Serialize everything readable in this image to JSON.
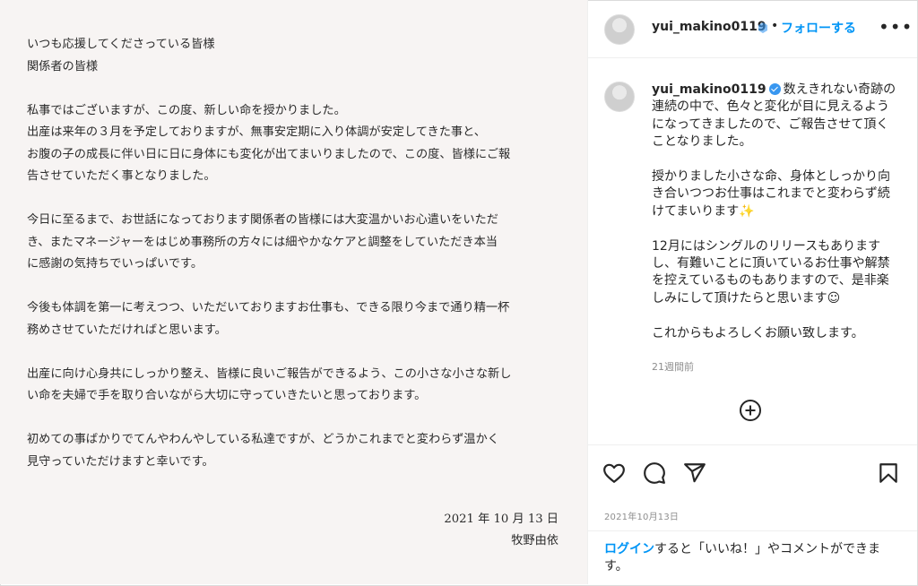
{
  "letter": {
    "paragraphs": [
      "いつも応援してくださっている皆様\n関係者の皆様",
      "私事ではございますが、この度、新しい命を授かりました。\n出産は来年の３月を予定しておりますが、無事安定期に入り体調が安定してきた事と、\nお腹の子の成長に伴い日に日に身体にも変化が出てまいりましたので、この度、皆様にご報\n告させていただく事となりました。",
      "今日に至るまで、お世話になっております関係者の皆様には大変温かいお心遣いをいただ\nき、またマネージャーをはじめ事務所の方々には細やかなケアと調整をしていただき本当\nに感謝の気持ちでいっぱいです。",
      "今後も体調を第一に考えつつ、いただいておりますお仕事も、できる限り今まで通り精一杯\n務めさせていただければと思います。",
      "出産に向け心身共にしっかり整え、皆様に良いご報告ができるよう、この小さな小さな新し\nい命を夫婦で手を取り合いながら大切に守っていきたいと思っております。",
      "初めての事ばかりでてんやわんやしている私達ですが、どうかこれまでと変わらず温かく\n見守っていただけますと幸いです。"
    ],
    "date": "2021 年 10 月 13 日",
    "signature": "牧野由依"
  },
  "header": {
    "username": "yui_makino0119",
    "separator": "•",
    "follow_label": "フォローする",
    "more_label": "•••"
  },
  "comment": {
    "username": "yui_makino0119",
    "text": "数えきれない奇跡の連続の中で、色々と変化が目に見えるようになってきましたので、ご報告させて頂くことなりました。\n\n授かりました小さな命、身体としっかり向き合いつつお仕事はこれまでと変わらず続けてまいります✨\n\n12月にはシングルのリリースもあります し、有難いことに頂いているお仕事や解禁を控えているものもありますので、是非楽しみにして頂けたらと思います☺\n\nこれからもよろしくお願い致します。",
    "time_ago": "21週間前"
  },
  "post": {
    "date": "2021年10月13日",
    "login_link": "ログイン",
    "login_rest": "すると「いいね！」やコメントができます。"
  },
  "colors": {
    "accent": "#0095f6",
    "verified": "#3897f0",
    "letter_bg": "#f7f4f3"
  },
  "icons": [
    "heart-icon",
    "comment-icon",
    "share-icon",
    "bookmark-icon",
    "plus-circle-icon",
    "verified-icon"
  ]
}
